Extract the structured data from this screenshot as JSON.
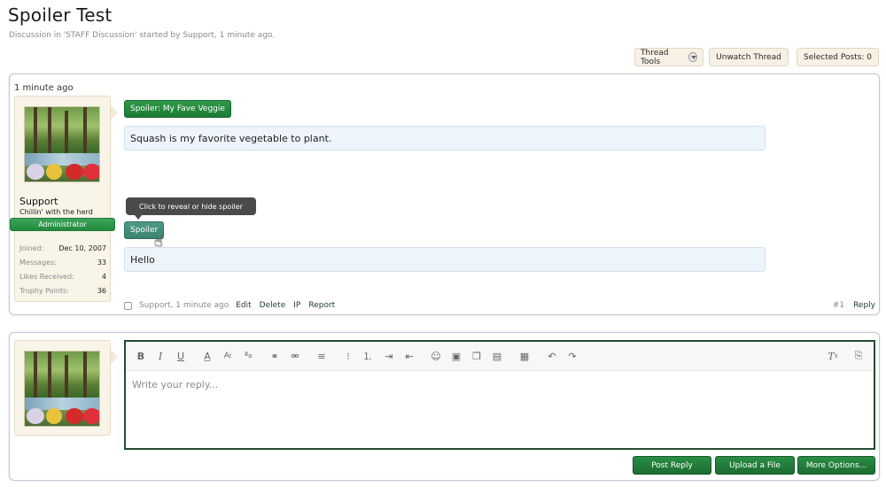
{
  "thread": {
    "title": "Spoiler Test",
    "subtitle": "Discussion in 'STAFF Discussion' started by Support, 1 minute ago."
  },
  "tools": {
    "thread_tools": "Thread Tools",
    "unwatch": "Unwatch Thread",
    "selected_posts": "Selected Posts: 0"
  },
  "post": {
    "date": "1 minute ago",
    "author": {
      "name": "Support",
      "title": "Chillin' with the herd",
      "role": "Administrator",
      "stats": [
        {
          "label": "Joined:",
          "value": "Dec 10, 2007"
        },
        {
          "label": "Messages:",
          "value": "33"
        },
        {
          "label": "Likes Received:",
          "value": "4"
        },
        {
          "label": "Trophy Points:",
          "value": "36"
        }
      ]
    },
    "spoiler1": {
      "button": "Spoiler: My Fave Veggie",
      "content": "Squash is my favorite vegetable to plant."
    },
    "tooltip": "Click to reveal or hide spoiler",
    "spoiler2": {
      "button": "Spoiler",
      "content": "Hello"
    },
    "footer": {
      "meta": "Support, 1 minute ago",
      "edit": "Edit",
      "delete": "Delete",
      "ip": "IP",
      "report": "Report",
      "number": "#1",
      "reply": "Reply"
    }
  },
  "reply": {
    "placeholder": "Write your reply...",
    "post_reply": "Post Reply",
    "upload": "Upload a File",
    "more": "More Options..."
  }
}
